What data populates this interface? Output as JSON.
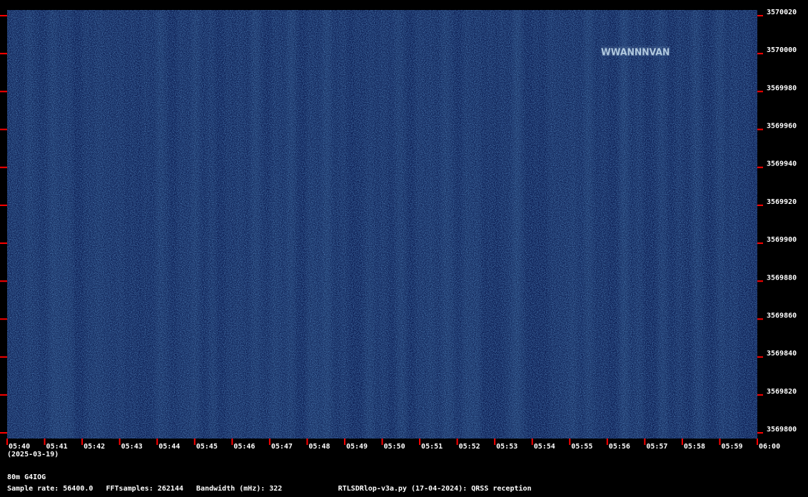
{
  "chart_data": {
    "type": "heatmap",
    "title": "",
    "xlabel": "",
    "ylabel": "",
    "x_ticks": [
      "05:40",
      "05:41",
      "05:42",
      "05:43",
      "05:44",
      "05:45",
      "05:46",
      "05:47",
      "05:48",
      "05:49",
      "05:50",
      "05:51",
      "05:52",
      "05:53",
      "05:54",
      "05:55",
      "05:56",
      "05:57",
      "05:58",
      "05:59",
      "06:00"
    ],
    "date": "(2025-03-19)",
    "y_ticks": [
      3570020,
      3570000,
      3569980,
      3569960,
      3569940,
      3569920,
      3569900,
      3569880,
      3569860,
      3569840,
      3569820,
      3569800
    ],
    "ylim": [
      3569797,
      3570023
    ],
    "xlim": [
      "05:40",
      "06:00"
    ],
    "signals": [
      {
        "start": "05:55:50",
        "end": "05:57:40",
        "freq": 3570001,
        "text": "WWANNNVAN"
      }
    ],
    "colors": {
      "background": "#0a1a4f",
      "noise": "#1c4a8e",
      "signal": "#c8e0f0",
      "tick": "#ff0000"
    }
  },
  "footer": {
    "station": "80m G4IOG",
    "sample_rate": "Sample rate: 56400.0",
    "fft_samples": "FFTsamples: 262144",
    "bandwidth": "Bandwidth (mHz): 322",
    "software": "RTLSDRlop-v3a.py (17-04-2024): QRSS reception"
  }
}
